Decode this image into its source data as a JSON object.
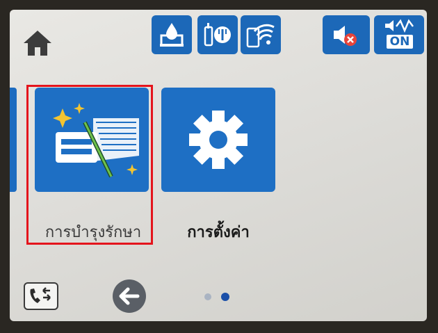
{
  "status_icons": [
    "ink-level-icon",
    "service-access-icon",
    "wifi-icon",
    "sound-muted-icon",
    "quiet-mode-icon"
  ],
  "quiet_mode_text": "ON",
  "tiles": [
    {
      "label": "การบำรุงรักษา",
      "icon": "maintenance-icon",
      "highlighted": true
    },
    {
      "label": "การตั้งค่า",
      "icon": "gear-icon"
    }
  ],
  "pager": {
    "pages": 2,
    "current": 2
  },
  "colors": {
    "tile": "#1e6fc4",
    "highlight": "#e4141c",
    "screen": "#e4e3df"
  }
}
